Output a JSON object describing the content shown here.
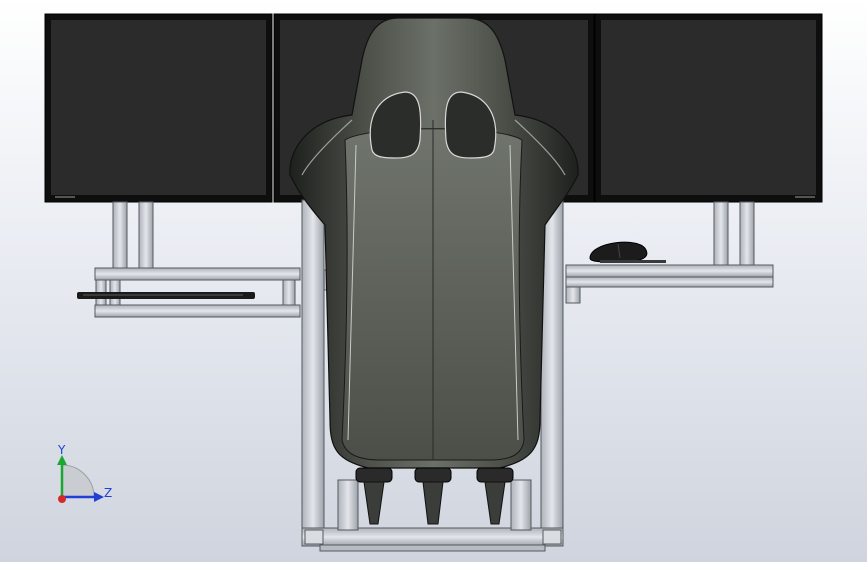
{
  "triad": {
    "labels": {
      "y": "Y",
      "z": "Z"
    },
    "colors": {
      "y": "#1aa832",
      "z": "#1f3fd6",
      "x": "#d42a2a"
    }
  },
  "theme": {
    "bg_top": "#ffffff",
    "bg_bottom": "#cfd4de",
    "monitor": "#2b2b2b",
    "monitor_bezel": "#111111",
    "seat_shell": "#2e312d",
    "seat_panel": "#5a5e57",
    "profile": "#cfd3d8",
    "profile_edge": "#555a60"
  },
  "icons": [
    "mouse-icon",
    "keyboard-icon",
    "triad-icon"
  ]
}
